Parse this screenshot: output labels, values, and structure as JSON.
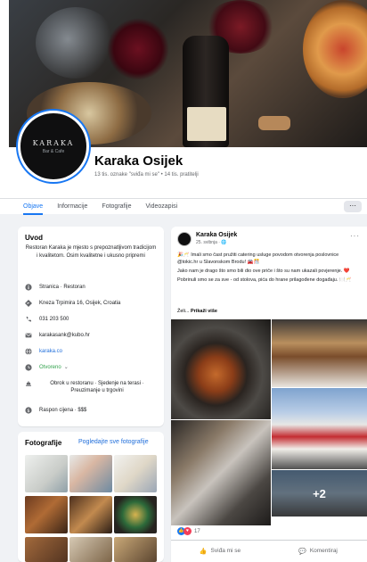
{
  "page": {
    "name": "Karaka Osijek",
    "stats": "13 tis. oznake \"sviđa mi se\" • 14 tis. pratitelji",
    "logo_text": "KARAKA",
    "logo_sub": "Bar & Cafe"
  },
  "tabs": [
    {
      "label": "Objave",
      "active": true
    },
    {
      "label": "Informacije"
    },
    {
      "label": "Fotografije"
    },
    {
      "label": "Videozapisi"
    }
  ],
  "tab_more": "···",
  "intro": {
    "title": "Uvod",
    "description": "Restoran Karaka je mjesto s prepoznatljivom tradicijom i kvalitetom. Osim kvalitetne i ukusno pripremi",
    "category": "Stranica · Restoran",
    "address": "Kneza Trpimira 16, Osijek, Croatia",
    "phone": "031 203 500",
    "email": "karakasank@kubo.hr",
    "website": "karaka.co",
    "status": "Otvoreno",
    "services": "Obrok u restoranu · Sjedenje na terasi · Preuzimanje u trgovini",
    "price": "Raspon cijena · $$$"
  },
  "photos": {
    "title": "Fotografije",
    "see_all": "Pogledajte sve fotografije"
  },
  "post": {
    "author": "Karaka Osijek",
    "date": "25. svibnja · 🌐",
    "paragraphs": [
      "🎉🥂 Imali smo čast pružiti catering usluge povodom otvorenja poslovnice @tokic.hr u Slavonskom Brodu! 🚘🎊",
      "Jako nam je drago što smo bili dio ove priče i što su nam ukazali povjerenje. ❤️",
      "Pobrinuli smo se za sve - od stolova, pića do hrane prilagođene događaju. 🍽️🥂"
    ],
    "more_prefix": "Želi...",
    "more_label": "Prikaži više",
    "extra_photos": "+2",
    "reaction_count": "17",
    "like_label": "Sviđa mi se",
    "comment_label": "Komentiraj"
  },
  "colors": {
    "accent": "#1877f2",
    "link": "#216fdb",
    "open_green": "#31a24c",
    "background": "#f0f2f5"
  }
}
